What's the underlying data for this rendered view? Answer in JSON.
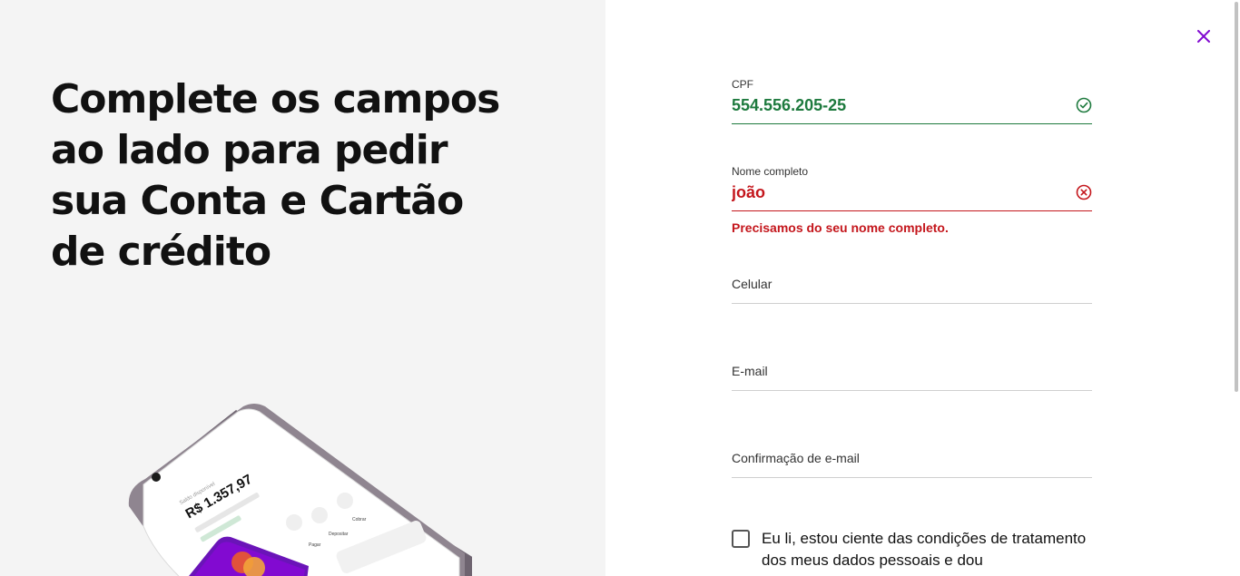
{
  "headline": "Complete os campos ao lado para pedir sua Conta e Cartão de crédito",
  "phone": {
    "balance_label": "Saldo disponível",
    "balance_value": "R$ 1.357,97",
    "actions": [
      "Pagar",
      "Depositar",
      "Cobrar"
    ]
  },
  "form": {
    "cpf": {
      "label": "CPF",
      "value": "554.556.205-25",
      "status": "valid"
    },
    "nome": {
      "label": "Nome completo",
      "value": "joão",
      "status": "error",
      "error": "Precisamos do seu nome completo."
    },
    "celular": {
      "label": "Celular"
    },
    "email": {
      "label": "E-mail"
    },
    "email_conf": {
      "label": "Confirmação de e-mail"
    },
    "consent": "Eu li, estou ciente das condições de tratamento dos meus dados pessoais e dou"
  },
  "colors": {
    "valid": "#1e7a3e",
    "error": "#c4161c",
    "accent": "#820ad1"
  }
}
